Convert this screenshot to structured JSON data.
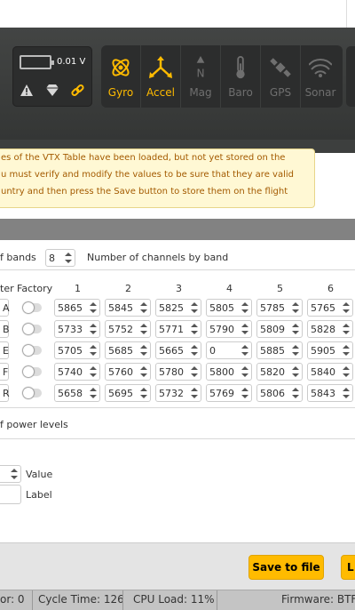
{
  "header": {
    "voltage": "0.01 V",
    "sensors": [
      {
        "icon": "gyro-icon",
        "label": "Gyro",
        "active": true
      },
      {
        "icon": "accel-icon",
        "label": "Accel",
        "active": true
      },
      {
        "icon": "mag-icon",
        "label": "Mag",
        "active": false
      },
      {
        "icon": "baro-icon",
        "label": "Baro",
        "active": false
      },
      {
        "icon": "gps-icon",
        "label": "GPS",
        "active": false
      },
      {
        "icon": "sonar-icon",
        "label": "Sonar",
        "active": false
      }
    ],
    "active_color": "#ffbb00",
    "inactive_color": "#6f6f6f"
  },
  "warning": {
    "line1": "es of the VTX Table have been loaded, but not yet stored on the",
    "line2": "u must verify and modify the values to be sure that they are valid",
    "line3": "untry and then press the Save button to store them on the flight"
  },
  "bands": {
    "count_label": "f bands",
    "count_value": "8",
    "channels_label": "Number of channels by band",
    "col_header": "ter",
    "factory_header": "Factory",
    "channel_headers": [
      "1",
      "2",
      "3",
      "4",
      "5",
      "6"
    ],
    "rows": [
      {
        "letter": "A",
        "values": [
          "5865",
          "5845",
          "5825",
          "5805",
          "5785",
          "5765"
        ]
      },
      {
        "letter": "B",
        "values": [
          "5733",
          "5752",
          "5771",
          "5790",
          "5809",
          "5828"
        ]
      },
      {
        "letter": "E",
        "values": [
          "5705",
          "5685",
          "5665",
          "0",
          "5885",
          "5905"
        ]
      },
      {
        "letter": "F",
        "values": [
          "5740",
          "5760",
          "5780",
          "5800",
          "5820",
          "5840"
        ]
      },
      {
        "letter": "R",
        "values": [
          "5658",
          "5695",
          "5732",
          "5769",
          "5806",
          "5843"
        ]
      }
    ]
  },
  "power": {
    "levels_label": "f power levels",
    "value_label": "Value",
    "label_label": "Label"
  },
  "buttons": {
    "save_to_file": "Save to file",
    "load": "L"
  },
  "status": {
    "errors": "or: 0",
    "cycle_time": "Cycle Time: 126",
    "cpu_load": "CPU Load: 11%",
    "firmware": "Firmware: BTFL"
  }
}
